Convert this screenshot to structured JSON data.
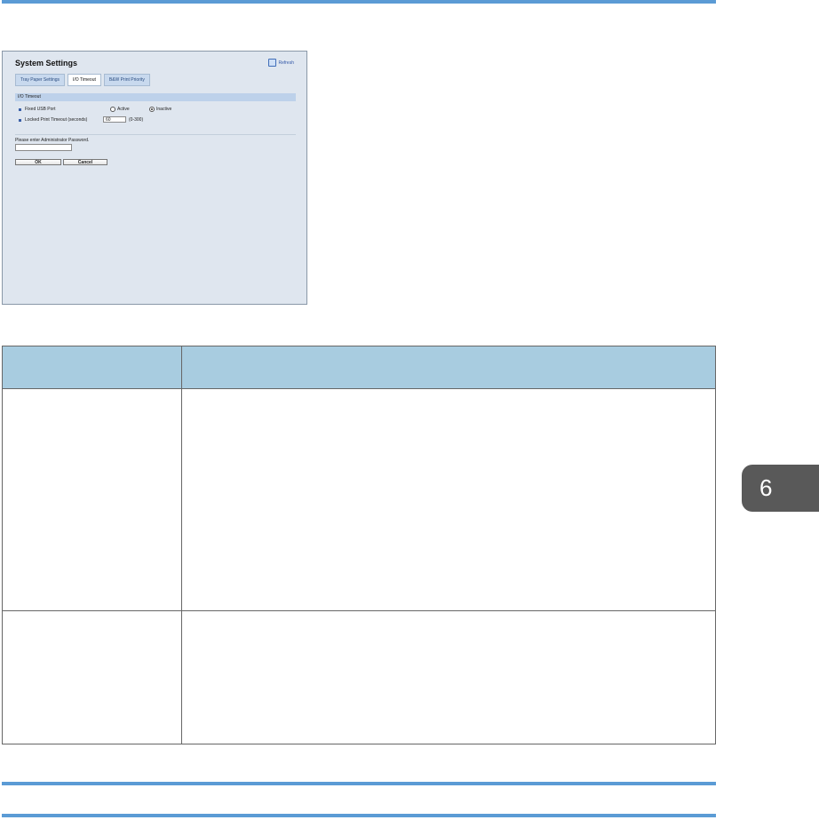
{
  "screenshot": {
    "title": "System Settings",
    "refresh_label": "Refresh",
    "tabs": [
      {
        "label": "Tray Paper Settings",
        "active": false
      },
      {
        "label": "I/O Timeout",
        "active": true
      },
      {
        "label": "B&W Print Priority",
        "active": false
      }
    ],
    "section_header": "I/O Timeout",
    "fixed_usb": {
      "label": "Fixed USB Port",
      "options": [
        {
          "label": "Active",
          "selected": false
        },
        {
          "label": "Inactive",
          "selected": true
        }
      ]
    },
    "locked_print": {
      "label": "Locked Print Timeout (seconds)",
      "value": "60",
      "range": "(0-300)"
    },
    "password_label": "Please enter Administrator Password.",
    "ok_label": "OK",
    "cancel_label": "Cancel"
  },
  "table": {
    "headers": [
      "",
      ""
    ],
    "rows": [
      {
        "item": "",
        "description": ""
      },
      {
        "item": "",
        "description": ""
      }
    ]
  },
  "chapter_tab": "6",
  "colors": {
    "rule": "#5b9bd5",
    "table_header": "#a8cce0",
    "chapter_tab": "#595959"
  }
}
